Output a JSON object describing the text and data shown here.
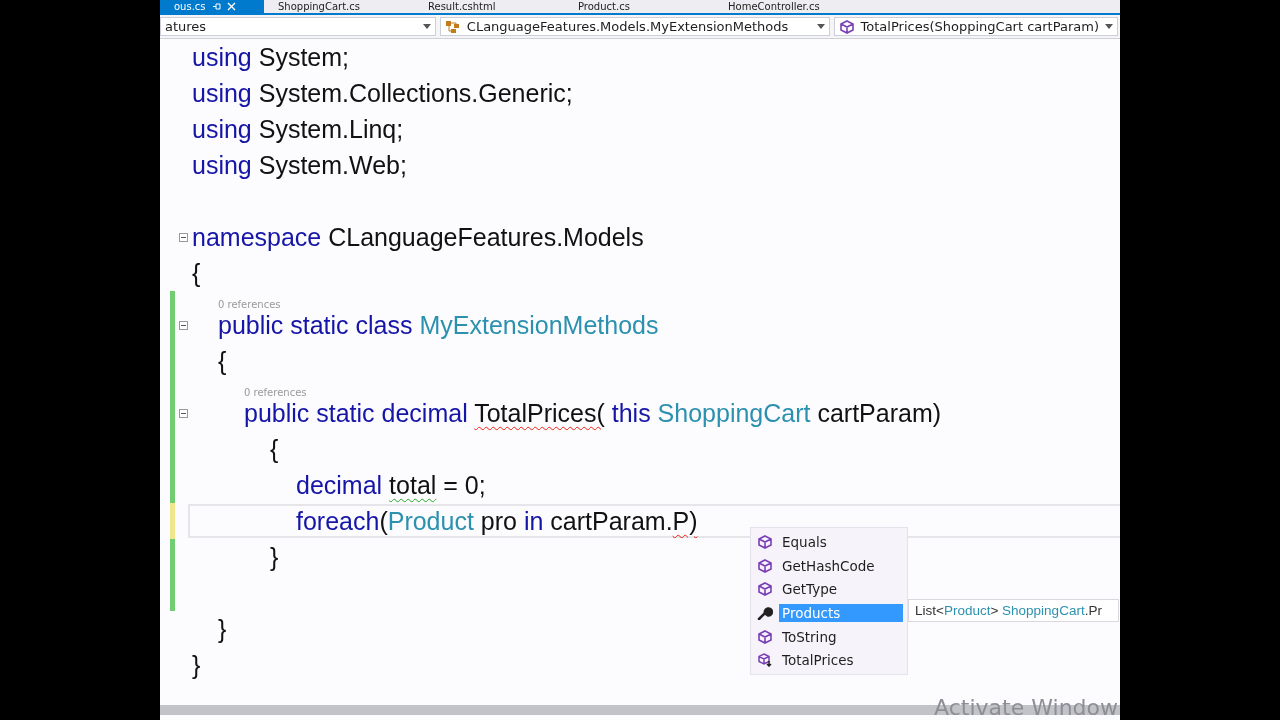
{
  "tabs": [
    {
      "label": "ous.cs",
      "selected": true
    },
    {
      "label": "ShoppingCart.cs",
      "selected": false
    },
    {
      "label": "Result.cshtml",
      "selected": false
    },
    {
      "label": "Product.cs",
      "selected": false
    },
    {
      "label": "HomeController.cs",
      "selected": false
    }
  ],
  "navigation_bar": [
    {
      "text": "atures",
      "kind": "plain"
    },
    {
      "text": "CLanguageFeatures.Models.MyExtensionMethods",
      "kind": "class"
    },
    {
      "text": "TotalPrices(ShoppingCart cartParam)",
      "kind": "method"
    }
  ],
  "code": [
    {
      "kind": "code",
      "tokens": [
        {
          "kind": "keyword",
          "text": "using"
        },
        {
          "kind": "plain",
          "text": " System;"
        }
      ]
    },
    {
      "kind": "code",
      "tokens": [
        {
          "kind": "keyword",
          "text": "using"
        },
        {
          "kind": "plain",
          "text": " System.Collections.Generic;"
        }
      ]
    },
    {
      "kind": "code",
      "tokens": [
        {
          "kind": "keyword",
          "text": "using"
        },
        {
          "kind": "plain",
          "text": " System.Linq;"
        }
      ]
    },
    {
      "kind": "code",
      "tokens": [
        {
          "kind": "keyword",
          "text": "using"
        },
        {
          "kind": "plain",
          "text": " System.Web;"
        }
      ]
    },
    {
      "kind": "blank"
    },
    {
      "kind": "code",
      "fold": true,
      "tokens": [
        {
          "kind": "keyword",
          "text": "namespace"
        },
        {
          "kind": "plain",
          "text": " CLanguageFeatures.Models"
        }
      ]
    },
    {
      "kind": "code",
      "tokens": [
        {
          "kind": "plain",
          "text": "{"
        }
      ]
    },
    {
      "kind": "block",
      "children": [
        {
          "kind": "lens",
          "text": "0 references",
          "modified": true,
          "saved": true
        },
        {
          "kind": "code",
          "fold": true,
          "modified": true,
          "saved": true,
          "tokens": [
            {
              "kind": "keyword",
              "text": "public static class "
            },
            {
              "kind": "type",
              "text": "MyExtensionMethods"
            }
          ]
        },
        {
          "kind": "code",
          "modified": true,
          "saved": true,
          "tokens": [
            {
              "kind": "plain",
              "text": "{"
            }
          ]
        },
        {
          "kind": "block",
          "children": [
            {
              "kind": "lens",
              "text": "0 references",
              "modified": true,
              "saved": true
            },
            {
              "kind": "code",
              "fold": true,
              "modified": true,
              "saved": true,
              "tokens": [
                {
                  "kind": "keyword",
                  "text": "public static decimal "
                },
                {
                  "kind": "plain",
                  "text": "TotalPrices(",
                  "error": true
                },
                {
                  "kind": "keyword",
                  "text": " this "
                },
                {
                  "kind": "type",
                  "text": "ShoppingCart"
                },
                {
                  "kind": "plain",
                  "text": " cartParam)"
                }
              ]
            },
            {
              "kind": "block",
              "children": [
                {
                  "kind": "code",
                  "modified": true,
                  "saved": true,
                  "tokens": [
                    {
                      "kind": "plain",
                      "text": "{"
                    }
                  ]
                },
                {
                  "kind": "block",
                  "children": [
                    {
                      "kind": "code",
                      "modified": true,
                      "saved": true,
                      "tokens": [
                        {
                          "kind": "keyword",
                          "text": "decimal "
                        },
                        {
                          "kind": "plain",
                          "text": "total",
                          "warning": true
                        },
                        {
                          "kind": "plain",
                          "text": " = 0;"
                        }
                      ]
                    },
                    {
                      "kind": "code",
                      "modified": true,
                      "saved": false,
                      "current": true,
                      "tokens": [
                        {
                          "kind": "keyword",
                          "text": "foreach"
                        },
                        {
                          "kind": "plain",
                          "text": "("
                        },
                        {
                          "kind": "type",
                          "text": "Product"
                        },
                        {
                          "kind": "plain",
                          "text": " pro "
                        },
                        {
                          "kind": "keyword",
                          "text": "in"
                        },
                        {
                          "kind": "plain",
                          "text": " cartParam."
                        },
                        {
                          "kind": "plain",
                          "text": "P)",
                          "error": true
                        }
                      ]
                    }
                  ]
                },
                {
                  "kind": "code",
                  "modified": true,
                  "saved": true,
                  "tokens": [
                    {
                      "kind": "plain",
                      "text": "}"
                    }
                  ]
                }
              ]
            },
            {
              "kind": "blank",
              "modified": true,
              "saved": true
            }
          ]
        },
        {
          "kind": "code",
          "tokens": [
            {
              "kind": "plain",
              "text": "}"
            }
          ]
        }
      ]
    },
    {
      "kind": "code",
      "tokens": [
        {
          "kind": "plain",
          "text": "}"
        }
      ]
    }
  ],
  "completion_list": [
    {
      "label": "Equals",
      "kind": "method",
      "selected": false
    },
    {
      "label": "GetHashCode",
      "kind": "method",
      "selected": false
    },
    {
      "label": "GetType",
      "kind": "method",
      "selected": false
    },
    {
      "label": "Products",
      "kind": "property",
      "selected": true
    },
    {
      "label": "ToString",
      "kind": "method",
      "selected": false
    },
    {
      "label": "TotalPrices",
      "kind": "extension",
      "selected": false
    }
  ],
  "completion_tooltip": [
    {
      "kind": "plain",
      "text": "List"
    },
    {
      "kind": "plain",
      "text": "<"
    },
    {
      "kind": "type",
      "text": "Product"
    },
    {
      "kind": "plain",
      "text": ">"
    },
    {
      "kind": "type",
      "text": " ShoppingCart"
    },
    {
      "kind": "plain",
      "text": ".Pr"
    }
  ],
  "system_notice": "Activate Window"
}
